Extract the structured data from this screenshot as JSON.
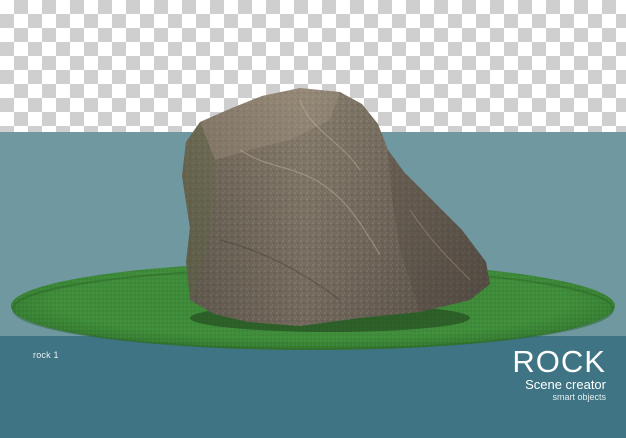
{
  "scene": {
    "item_label": "rock 1",
    "title": "ROCK",
    "subtitle": "Scene creator",
    "caption": "smart objects"
  },
  "colors": {
    "backdrop": "#6f98a0",
    "floor_band": "#3e7483",
    "grass": "#3f8a3a",
    "rock": "#7d7468",
    "text": "#ffffff"
  }
}
